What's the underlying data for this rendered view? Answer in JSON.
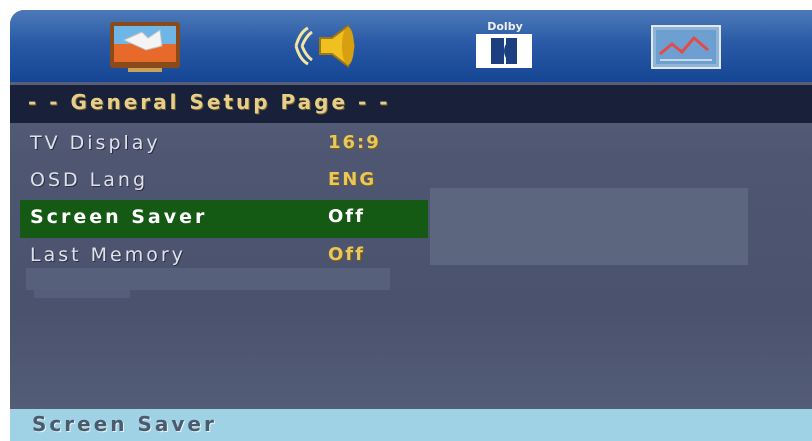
{
  "top_icons": [
    {
      "icon": "general-setup-tv-icon",
      "selected": true
    },
    {
      "icon": "audio-speaker-icon"
    },
    {
      "icon": "dolby-digital-icon",
      "label": "Dolby"
    },
    {
      "icon": "preference-picture-icon"
    }
  ],
  "page": {
    "title": "- -  General  Setup  Page  - -"
  },
  "menu": {
    "items": [
      {
        "label": "TV  Display",
        "value": "16:9"
      },
      {
        "label": "OSD  Lang",
        "value": "ENG"
      },
      {
        "label": "Screen  Saver",
        "value": "Off",
        "selected": true
      },
      {
        "label": "Last  Memory",
        "value": "Off"
      }
    ]
  },
  "status": {
    "text": "Screen  Saver"
  },
  "colors": {
    "icon_bar": "#2a5aa6",
    "title_bar": "#19213a",
    "background": "#4e5672",
    "selected_row": "#145a14",
    "value_text": "#e9c75a",
    "status_bar": "#9fd2e4"
  }
}
